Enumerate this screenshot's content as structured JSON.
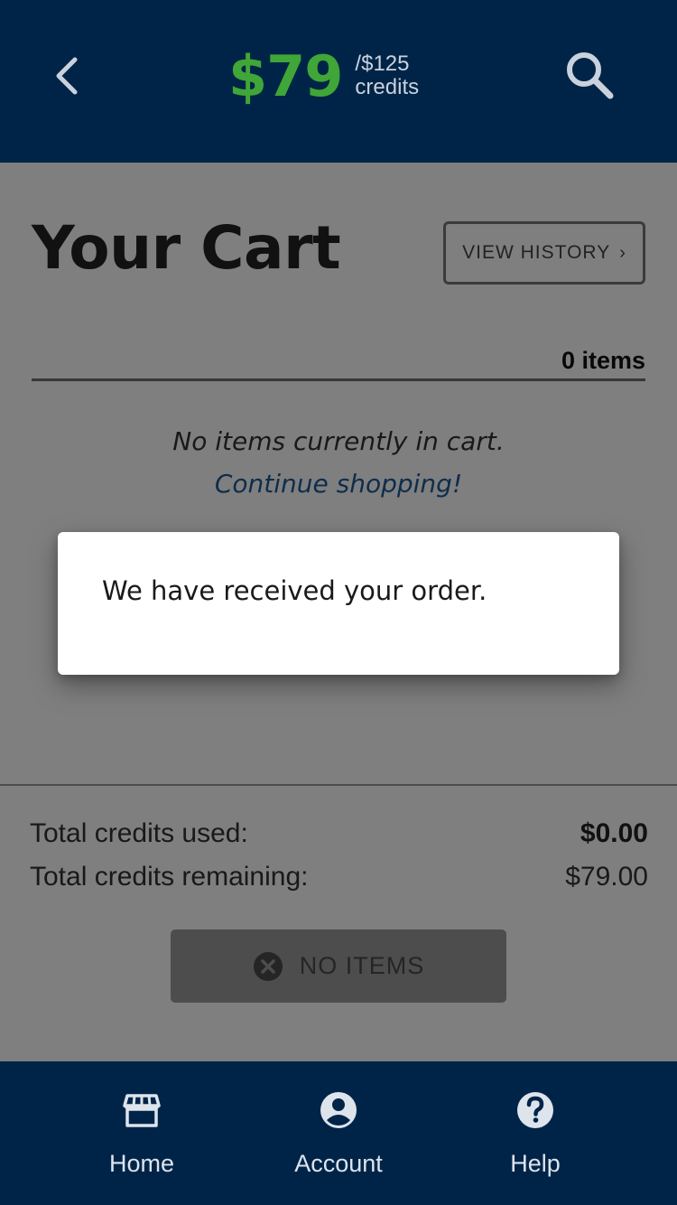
{
  "header": {
    "credits_amount": "$79",
    "credits_total": "/$125",
    "credits_label": "credits",
    "back_icon": "chevron-left-icon",
    "search_icon": "search-icon"
  },
  "cart": {
    "title": "Your Cart",
    "history_label": "VIEW HISTORY",
    "history_chevron": "›",
    "items_count": "0 items",
    "empty_message": "No items currently in cart.",
    "continue_link": "Continue shopping!"
  },
  "summary": {
    "used_label": "Total credits used:",
    "used_value": "$0.00",
    "remaining_label": "Total credits remaining:",
    "remaining_value": "$79.00",
    "checkout_label": "NO ITEMS"
  },
  "dialog": {
    "message": "We have received your order."
  },
  "nav": {
    "items": [
      {
        "label": "Home",
        "icon": "store-icon"
      },
      {
        "label": "Account",
        "icon": "account-circle-icon"
      },
      {
        "label": "Help",
        "icon": "help-circle-icon"
      }
    ]
  },
  "colors": {
    "header_bg": "#002448",
    "credits_green": "#3fa637",
    "link_blue": "#1f5b96",
    "overlay": "rgba(0,0,0,0.5)"
  }
}
